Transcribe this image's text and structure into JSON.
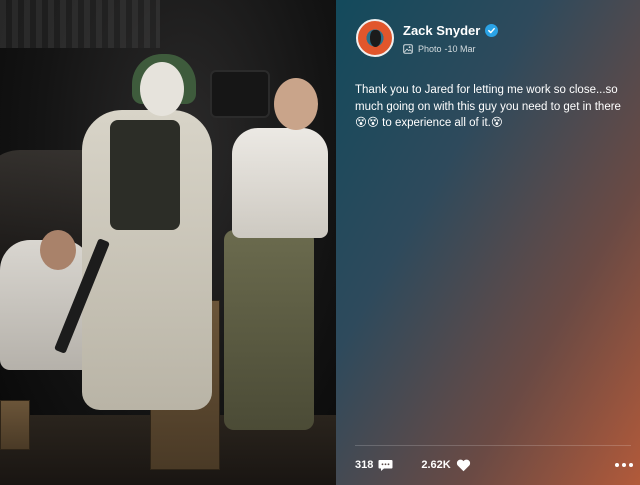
{
  "post": {
    "author": "Zack Snyder",
    "verified": true,
    "type_label": "Photo",
    "date": "-10 Mar",
    "caption": "Thank you to Jared for letting me work so close...so much going on with this guy you need to get in there 😵😵 to experience all of it.😵",
    "comments_count": "318",
    "likes_count": "2.62K"
  },
  "icons": {
    "verified": "verified-check-icon",
    "photo": "photo-icon",
    "comment": "comment-bubble-icon",
    "like": "heart-icon",
    "more": "more-dots-icon"
  },
  "colors": {
    "verified_badge": "#2aa3e6",
    "panel_start": "#134a5c",
    "panel_end": "#b25a3a"
  }
}
